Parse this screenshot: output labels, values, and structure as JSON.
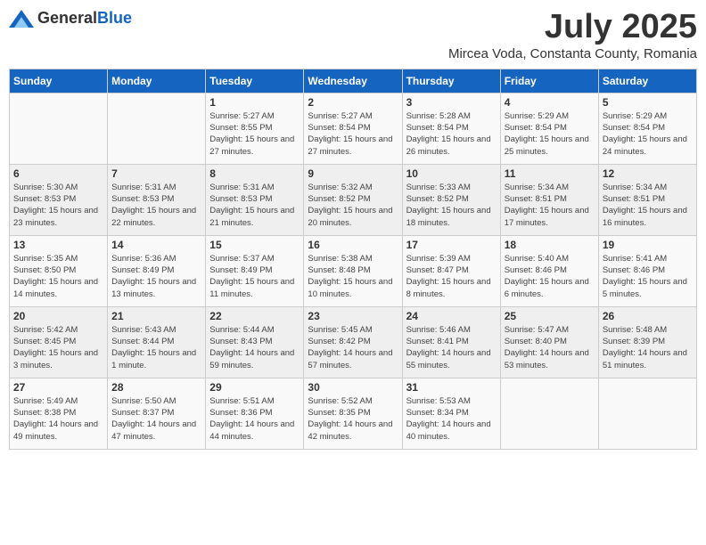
{
  "header": {
    "logo_general": "General",
    "logo_blue": "Blue",
    "month": "July 2025",
    "location": "Mircea Voda, Constanta County, Romania"
  },
  "columns": [
    "Sunday",
    "Monday",
    "Tuesday",
    "Wednesday",
    "Thursday",
    "Friday",
    "Saturday"
  ],
  "weeks": [
    {
      "days": [
        {
          "num": "",
          "info": ""
        },
        {
          "num": "",
          "info": ""
        },
        {
          "num": "1",
          "info": "Sunrise: 5:27 AM\nSunset: 8:55 PM\nDaylight: 15 hours\nand 27 minutes."
        },
        {
          "num": "2",
          "info": "Sunrise: 5:27 AM\nSunset: 8:54 PM\nDaylight: 15 hours\nand 27 minutes."
        },
        {
          "num": "3",
          "info": "Sunrise: 5:28 AM\nSunset: 8:54 PM\nDaylight: 15 hours\nand 26 minutes."
        },
        {
          "num": "4",
          "info": "Sunrise: 5:29 AM\nSunset: 8:54 PM\nDaylight: 15 hours\nand 25 minutes."
        },
        {
          "num": "5",
          "info": "Sunrise: 5:29 AM\nSunset: 8:54 PM\nDaylight: 15 hours\nand 24 minutes."
        }
      ]
    },
    {
      "days": [
        {
          "num": "6",
          "info": "Sunrise: 5:30 AM\nSunset: 8:53 PM\nDaylight: 15 hours\nand 23 minutes."
        },
        {
          "num": "7",
          "info": "Sunrise: 5:31 AM\nSunset: 8:53 PM\nDaylight: 15 hours\nand 22 minutes."
        },
        {
          "num": "8",
          "info": "Sunrise: 5:31 AM\nSunset: 8:53 PM\nDaylight: 15 hours\nand 21 minutes."
        },
        {
          "num": "9",
          "info": "Sunrise: 5:32 AM\nSunset: 8:52 PM\nDaylight: 15 hours\nand 20 minutes."
        },
        {
          "num": "10",
          "info": "Sunrise: 5:33 AM\nSunset: 8:52 PM\nDaylight: 15 hours\nand 18 minutes."
        },
        {
          "num": "11",
          "info": "Sunrise: 5:34 AM\nSunset: 8:51 PM\nDaylight: 15 hours\nand 17 minutes."
        },
        {
          "num": "12",
          "info": "Sunrise: 5:34 AM\nSunset: 8:51 PM\nDaylight: 15 hours\nand 16 minutes."
        }
      ]
    },
    {
      "days": [
        {
          "num": "13",
          "info": "Sunrise: 5:35 AM\nSunset: 8:50 PM\nDaylight: 15 hours\nand 14 minutes."
        },
        {
          "num": "14",
          "info": "Sunrise: 5:36 AM\nSunset: 8:49 PM\nDaylight: 15 hours\nand 13 minutes."
        },
        {
          "num": "15",
          "info": "Sunrise: 5:37 AM\nSunset: 8:49 PM\nDaylight: 15 hours\nand 11 minutes."
        },
        {
          "num": "16",
          "info": "Sunrise: 5:38 AM\nSunset: 8:48 PM\nDaylight: 15 hours\nand 10 minutes."
        },
        {
          "num": "17",
          "info": "Sunrise: 5:39 AM\nSunset: 8:47 PM\nDaylight: 15 hours\nand 8 minutes."
        },
        {
          "num": "18",
          "info": "Sunrise: 5:40 AM\nSunset: 8:46 PM\nDaylight: 15 hours\nand 6 minutes."
        },
        {
          "num": "19",
          "info": "Sunrise: 5:41 AM\nSunset: 8:46 PM\nDaylight: 15 hours\nand 5 minutes."
        }
      ]
    },
    {
      "days": [
        {
          "num": "20",
          "info": "Sunrise: 5:42 AM\nSunset: 8:45 PM\nDaylight: 15 hours\nand 3 minutes."
        },
        {
          "num": "21",
          "info": "Sunrise: 5:43 AM\nSunset: 8:44 PM\nDaylight: 15 hours\nand 1 minute."
        },
        {
          "num": "22",
          "info": "Sunrise: 5:44 AM\nSunset: 8:43 PM\nDaylight: 14 hours\nand 59 minutes."
        },
        {
          "num": "23",
          "info": "Sunrise: 5:45 AM\nSunset: 8:42 PM\nDaylight: 14 hours\nand 57 minutes."
        },
        {
          "num": "24",
          "info": "Sunrise: 5:46 AM\nSunset: 8:41 PM\nDaylight: 14 hours\nand 55 minutes."
        },
        {
          "num": "25",
          "info": "Sunrise: 5:47 AM\nSunset: 8:40 PM\nDaylight: 14 hours\nand 53 minutes."
        },
        {
          "num": "26",
          "info": "Sunrise: 5:48 AM\nSunset: 8:39 PM\nDaylight: 14 hours\nand 51 minutes."
        }
      ]
    },
    {
      "days": [
        {
          "num": "27",
          "info": "Sunrise: 5:49 AM\nSunset: 8:38 PM\nDaylight: 14 hours\nand 49 minutes."
        },
        {
          "num": "28",
          "info": "Sunrise: 5:50 AM\nSunset: 8:37 PM\nDaylight: 14 hours\nand 47 minutes."
        },
        {
          "num": "29",
          "info": "Sunrise: 5:51 AM\nSunset: 8:36 PM\nDaylight: 14 hours\nand 44 minutes."
        },
        {
          "num": "30",
          "info": "Sunrise: 5:52 AM\nSunset: 8:35 PM\nDaylight: 14 hours\nand 42 minutes."
        },
        {
          "num": "31",
          "info": "Sunrise: 5:53 AM\nSunset: 8:34 PM\nDaylight: 14 hours\nand 40 minutes."
        },
        {
          "num": "",
          "info": ""
        },
        {
          "num": "",
          "info": ""
        }
      ]
    }
  ]
}
